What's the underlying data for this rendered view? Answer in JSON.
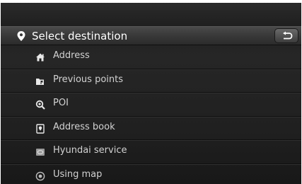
{
  "header": {
    "title": "Select destination",
    "icon": "location-pin-icon",
    "back_icon": "return-arrow-icon"
  },
  "menu": {
    "items": [
      {
        "label": "Address",
        "icon": "house-icon"
      },
      {
        "label": "Previous points",
        "icon": "folder-flag-icon"
      },
      {
        "label": "POI",
        "icon": "magnifier-pin-icon"
      },
      {
        "label": "Address book",
        "icon": "book-pin-icon"
      },
      {
        "label": "Hyundai service",
        "icon": "service-icon"
      },
      {
        "label": "Using map",
        "icon": "map-icon"
      }
    ]
  },
  "colors": {
    "background": "#202020",
    "header": "#3a3a3a",
    "text": "#d2d2d2",
    "title": "#ffffff"
  }
}
